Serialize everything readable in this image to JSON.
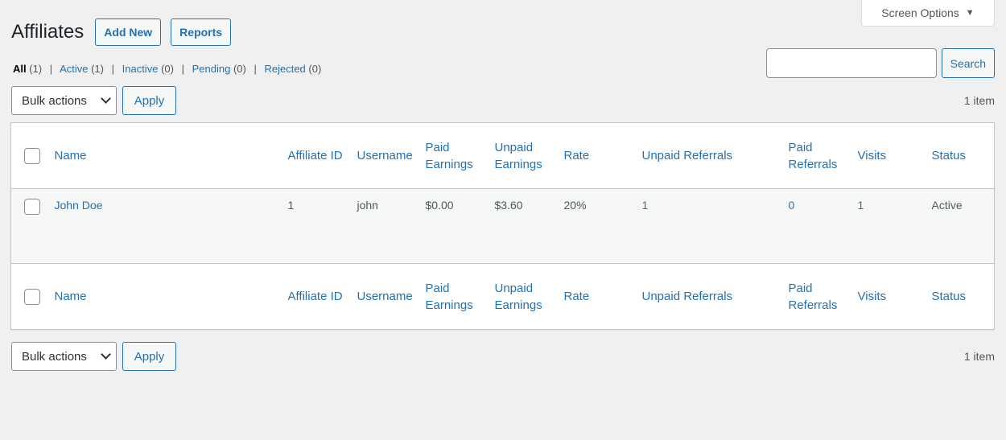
{
  "screen_options": {
    "label": "Screen Options",
    "icon": "triangle-down-icon"
  },
  "header": {
    "title": "Affiliates",
    "buttons": [
      {
        "label": "Add New"
      },
      {
        "label": "Reports"
      }
    ]
  },
  "filters": [
    {
      "label": "All",
      "count": "(1)",
      "current": true
    },
    {
      "label": "Active",
      "count": "(1)",
      "current": false
    },
    {
      "label": "Inactive",
      "count": "(0)",
      "current": false
    },
    {
      "label": "Pending",
      "count": "(0)",
      "current": false
    },
    {
      "label": "Rejected",
      "count": "(0)",
      "current": false
    }
  ],
  "separator": "|",
  "search": {
    "value": "",
    "placeholder": "",
    "button_label": "Search"
  },
  "tablenav": {
    "bulk_actions_label": "Bulk actions",
    "apply_label": "Apply",
    "items_count": "1 item"
  },
  "table": {
    "columns": [
      {
        "key": "name",
        "label": "Name"
      },
      {
        "key": "affiliate_id",
        "label": "Affiliate ID"
      },
      {
        "key": "username",
        "label": "Username"
      },
      {
        "key": "paid_earnings",
        "label": "Paid Earnings"
      },
      {
        "key": "unpaid_earnings",
        "label": "Unpaid Earnings"
      },
      {
        "key": "rate",
        "label": "Rate"
      },
      {
        "key": "unpaid_referrals",
        "label": "Unpaid Referrals"
      },
      {
        "key": "paid_referrals",
        "label": "Paid Referrals"
      },
      {
        "key": "visits",
        "label": "Visits"
      },
      {
        "key": "status",
        "label": "Status"
      }
    ],
    "rows": [
      {
        "name": "John Doe",
        "affiliate_id": "1",
        "username": "john",
        "paid_earnings": "$0.00",
        "unpaid_earnings": "$3.60",
        "rate": "20%",
        "unpaid_referrals": "1",
        "paid_referrals": "0",
        "visits": "1",
        "status": "Active"
      }
    ]
  },
  "colors": {
    "link": "#2271b1",
    "background": "#f0f0f1",
    "text": "#3c434a"
  }
}
